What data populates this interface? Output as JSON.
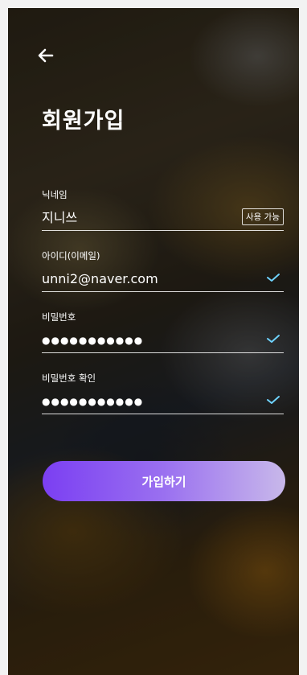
{
  "header": {
    "back_icon": "arrow-left-icon",
    "title": "회원가입"
  },
  "form": {
    "nickname": {
      "label": "닉네임",
      "value": "지니쓰",
      "badge": "사용 가능"
    },
    "email": {
      "label": "아이디(이메일)",
      "value": "unni2@naver.com",
      "status_icon": "check-icon"
    },
    "password": {
      "label": "비밀번호",
      "masked_value": "●●●●●●●●●●●",
      "status_icon": "check-icon"
    },
    "password_confirm": {
      "label": "비밀번호 확인",
      "masked_value": "●●●●●●●●●●●",
      "status_icon": "check-icon"
    }
  },
  "submit": {
    "label": "가입하기"
  },
  "colors": {
    "accent_start": "#7b3ff2",
    "accent_end": "#c8b8ea",
    "check": "#6fd3ff"
  }
}
